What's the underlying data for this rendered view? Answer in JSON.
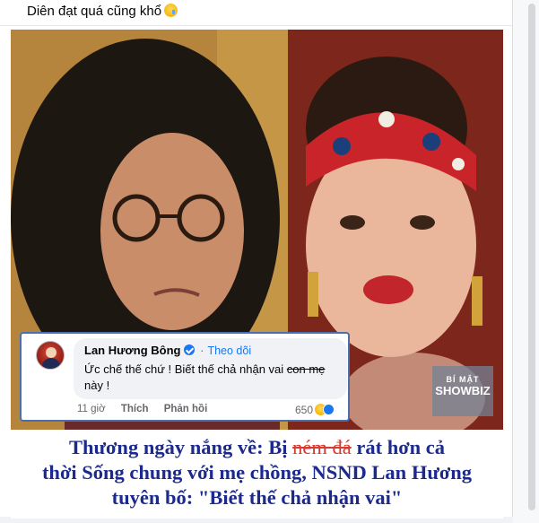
{
  "post": {
    "text": "Diên đạt quá cũng khổ",
    "emoji": "sad-tear-emoji"
  },
  "comment": {
    "author": "Lan Hương Bông",
    "separator": "·",
    "follow_label": "Theo dõi",
    "text_part1": "Ức chế thế chứ ! Biết thế chả nhận vai ",
    "text_struck": "con mẹ",
    "text_part2": " này !",
    "time": "11 giờ",
    "like_label": "Thích",
    "reply_label": "Phản hồi",
    "reaction_count": "650"
  },
  "watermark": {
    "line1": "BÍ MẬT",
    "line2": "SHOWBIZ"
  },
  "headline": {
    "part1": "Thương ngày nắng về: Bị ",
    "struck": "ném đá",
    "part2": " rát hơn cả",
    "line2": "thời Sống chung với mẹ chồng, NSND Lan Hương",
    "line3": "tuyên bố: \"Biết thế chả nhận vai\""
  },
  "colors": {
    "headline": "#1b2a8c",
    "accent": "#1877f2",
    "comment_border": "#4a6fb0"
  }
}
